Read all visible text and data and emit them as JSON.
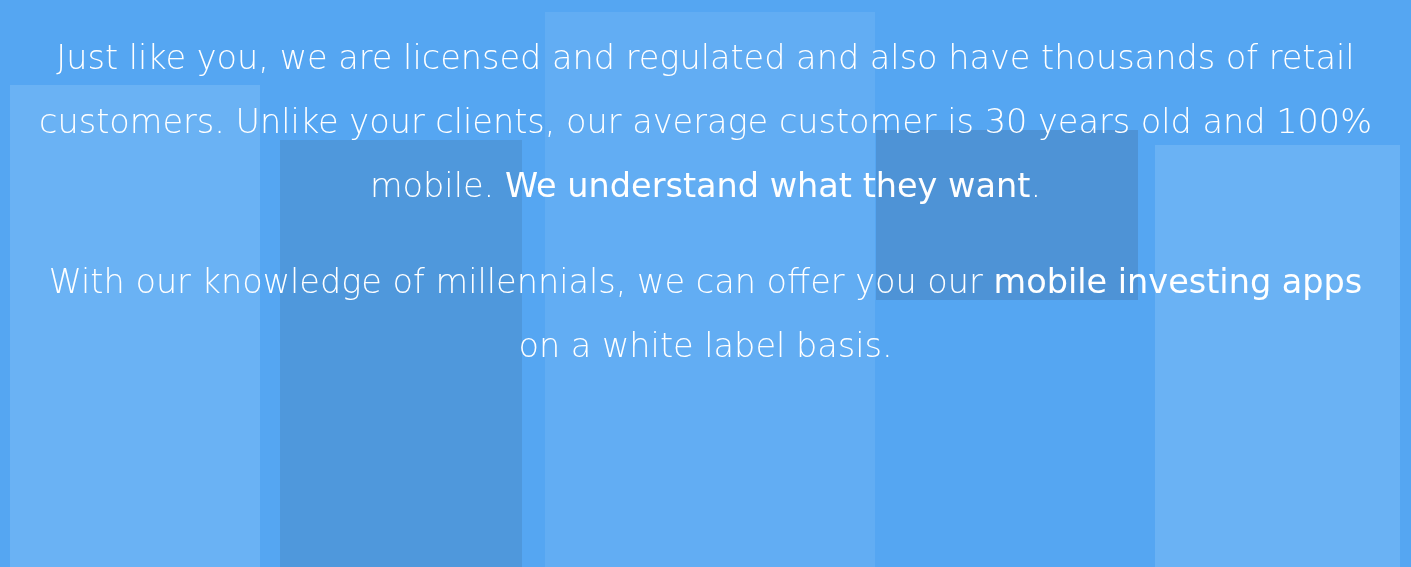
{
  "paragraphs": [
    "Just like you, we are licensed and regulated and also have thousands of retail customers. Unlike your clients, our average customer is 30 years old and 100% mobile. **We understand what they want**.",
    "With our knowledge of millennials, we can offer you our **mobile investing apps** on a white label basis."
  ]
}
